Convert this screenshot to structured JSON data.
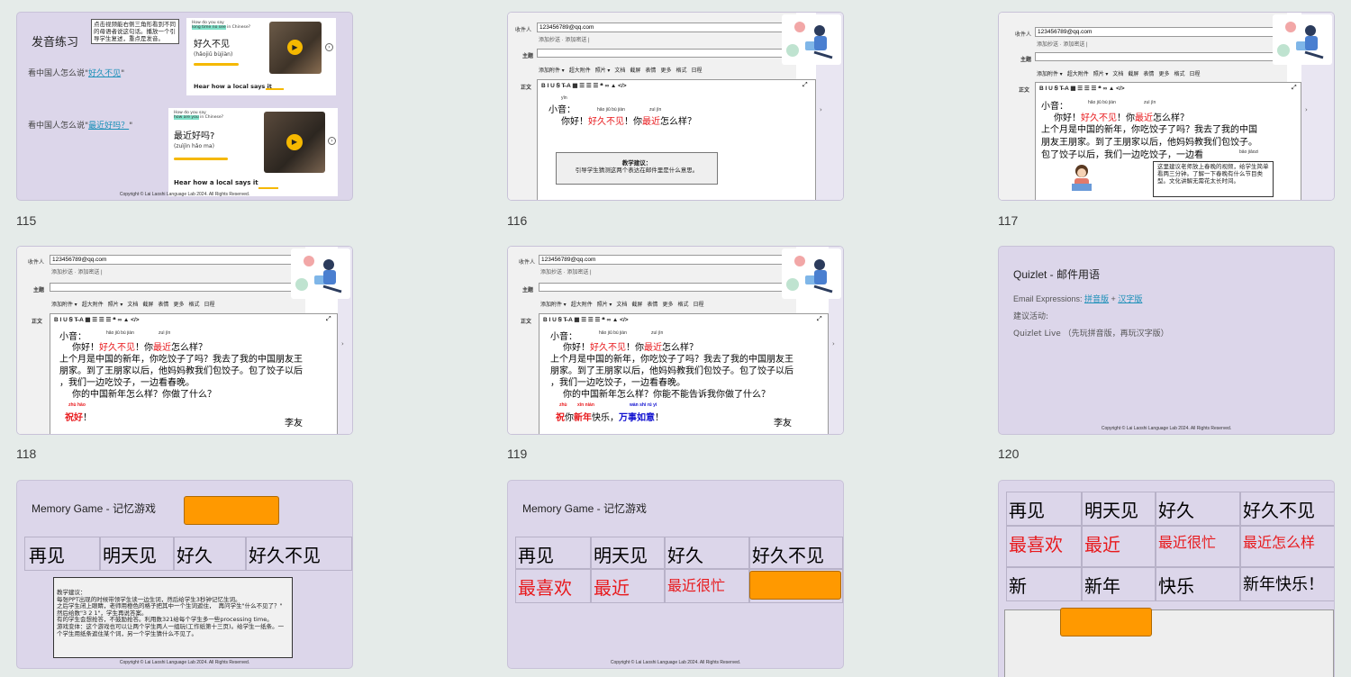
{
  "slides": {
    "s115": {
      "number": "115",
      "title": "发音练习",
      "callout": "点击视频能右侧三角形看到不同的母语者说这句话。播放一个引导学生复述，重点是发音。",
      "line1_prefix": "看中国人怎么说\"",
      "line1_link": "好久不见",
      "line1_suffix": "\"",
      "line2_prefix": "看中国人怎么说\"",
      "line2_link": "最近好吗？",
      "line2_suffix": "\"",
      "card1": {
        "q_top": "How do you say",
        "q_hl": "long time no see",
        "q_rest": " in Chinese?",
        "phrase": "好久不见",
        "pinyin": "(hǎojiǔ bùjiàn)",
        "hear": "Hear how a local says it"
      },
      "card2": {
        "q_top": "How do you say",
        "q_hl": "how are you",
        "q_rest": " in Chinese?",
        "phrase": "最近好吗?",
        "pinyin": "(zuìjìn hǎo ma)",
        "hear": "Hear how a local says it"
      },
      "copyright": "Copyright © Lai Laoshi Language Lab 2024. All Rights Reserved."
    },
    "s116": {
      "number": "116",
      "to_label": "收件人",
      "to_value": "123456789@qq.com",
      "links": "添加抄送 · 添加密送 |",
      "subject_label": "主题",
      "body_label": "正文",
      "toolbar": [
        "添加附件 ▾",
        "超大附件",
        "照片 ▾",
        "文档",
        "截屏",
        "表情",
        "更多",
        "格式",
        "日程"
      ],
      "fmt": "B  I  U  Ꞩ  T̶  A  ▦  ☰  ☰  ☰  ❝  ∞  ▲  </>",
      "py_yin": "yīn",
      "py1": "hǎo jiǔ bù jiàn",
      "py2": "zuì jìn",
      "greet": "小音：",
      "l1a": "你好！",
      "l1b": "好久不见",
      "l1c": "！你",
      "l1d": "最近",
      "l1e": "怎么样？",
      "note_title": "教学建议：",
      "note_body": "引导学生猜测这两个表达在邮件里是什么意思。"
    },
    "s117": {
      "number": "117",
      "to_label": "收件人",
      "to_value": "123456789@qq.com",
      "links": "添加抄送 · 添加密送 |",
      "subject_label": "主题",
      "body_label": "正文",
      "toolbar": [
        "添加附件 ▾",
        "超大附件",
        "照片 ▾",
        "文档",
        "截屏",
        "表情",
        "更多",
        "格式",
        "日程"
      ],
      "fmt": "B  I  U  Ꞩ  T̶  A  ▦  ☰  ☰  ☰  ❝  ∞  ▲  </>",
      "py1": "hǎo jiǔ bù jiàn",
      "py2": "zuì jìn",
      "py3": "bāo jiǎozi",
      "greet": "小音：",
      "l1a": "你好！",
      "l1b": "好久不见",
      "l1c": "！你",
      "l1d": "最近",
      "l1e": "怎么样？",
      "l2": "上个月是中国的新年，你吃饺子了吗？我去了我的中国",
      "l3": "朋友王朋家。到了王朋家以后，他妈妈教我们包饺子。",
      "l4": "包了饺子以后，我们一边吃饺子，一边看",
      "note": "这里建议老师放上春晚的视频，给学生简单看两三分钟。了解一下春晚有什么节目类型。文化讲解无需花太长时间。"
    },
    "s118": {
      "number": "118",
      "to_label": "收件人",
      "to_value": "123456789@qq.com",
      "links": "添加抄送 · 添加密送 |",
      "subject_label": "主题",
      "body_label": "正文",
      "toolbar": [
        "添加附件 ▾",
        "超大附件",
        "照片 ▾",
        "文档",
        "截屏",
        "表情",
        "更多",
        "格式",
        "日程"
      ],
      "fmt": "B  I  U  Ꞩ  T̶  A  ▦  ☰  ☰  ☰  ❝  ∞  ▲  </>",
      "py1": "hǎo jiǔ bù jiàn",
      "py2": "zuì jìn",
      "py_zhu": "zhù hǎo",
      "greet": "小音：",
      "l1a": "你好！",
      "l1b": "好久不见",
      "l1c": "！你",
      "l1d": "最近",
      "l1e": "怎么样？",
      "l2": "上个月是中国的新年，你吃饺子了吗？我去了我的中国朋友王",
      "l3": "朋家。到了王朋家以后，他妈妈教我们包饺子。包了饺子以后",
      "l4": "，我们一边吃饺子，一边看春晚。",
      "l5": "你的中国新年怎么样？你做了什么？",
      "wish": "祝好",
      "wish_end": "！",
      "sign": "李友"
    },
    "s119": {
      "number": "119",
      "to_label": "收件人",
      "to_value": "123456789@qq.com",
      "links": "添加抄送 · 添加密送 |",
      "subject_label": "主题",
      "body_label": "正文",
      "toolbar": [
        "添加附件 ▾",
        "超大附件",
        "照片 ▾",
        "文档",
        "截屏",
        "表情",
        "更多",
        "格式",
        "日程"
      ],
      "fmt": "B  I  U  Ꞩ  T̶  A  ▦  ☰  ☰  ☰  ❝  ∞  ▲  </>",
      "py1": "hǎo jiǔ bù jiàn",
      "py2": "zuì jìn",
      "py_zhu": "zhù",
      "py_xin": "xīn nián",
      "py_wan": "wàn shì rú  yì",
      "greet": "小音：",
      "l1a": "你好！",
      "l1b": "好久不见",
      "l1c": "！你",
      "l1d": "最近",
      "l1e": "怎么样？",
      "l2": "上个月是中国的新年，你吃饺子了吗？我去了我的中国朋友王",
      "l3": "朋家。到了王朋家以后，他妈妈教我们包饺子。包了饺子以后",
      "l4": "，我们一边吃饺子，一边看春晚。",
      "l5": "你的中国新年怎么样？你能不能告诉我你做了什么？",
      "w1": "祝",
      "w2": "你",
      "w3": "新年",
      "w4": "快乐，",
      "w5": "万事如意",
      "w6": "！",
      "sign": "李友"
    },
    "s120": {
      "number": "120",
      "title": "Quizlet - 邮件用语",
      "expr_prefix": "Email Expressions: ",
      "link1": "拼音版",
      "plus": " + ",
      "link2": "汉字版",
      "activity": "建议活动:",
      "live": "Quizlet Live （先玩拼音版，再玩汉字版）",
      "copyright": "Copyright © Lai Laoshi Language Lab 2024. All Rights Reserved."
    },
    "s121": {
      "title": "Memory Game - 记忆游戏",
      "words": [
        "再见",
        "明天见",
        "好久",
        "好久不见"
      ],
      "note": "教学建议：\n每张PPT出现的时候带领学生读一边生词，然后给学生3秒钟记忆生词。\n之后学生闭上眼睛，老师用橙色的格子把其中一个生词遮住，  再问学生\"什么不见了？\" 然后给数\"3 2 1\"，学生再说答案。\n有的学生会想抢答，不鼓励抢答。利用数321给每个学生多一些processing time。\n游戏变体：这个游戏也可以让两个学生两人一组玩(工作纸第十三页)。给学生一纸条。一个学生用纸条遮住某个词，另一个学生猜什么不见了。",
      "copyright": "Copyright © Lai Laoshi Language Lab 2024. All Rights Reserved."
    },
    "s122": {
      "title": "Memory Game - 记忆游戏",
      "row1": [
        "再见",
        "明天见",
        "好久",
        "好久不见"
      ],
      "row2": [
        "最喜欢",
        "最近",
        "最近很忙"
      ],
      "copyright": "Copyright © Lai Laoshi Language Lab 2024. All Rights Reserved."
    },
    "s123": {
      "row1": [
        "再见",
        "明天见",
        "好久",
        "好久不见"
      ],
      "row2": [
        "最喜欢",
        "最近",
        "最近很忙",
        "最近怎么样"
      ],
      "row3": [
        "新",
        "新年",
        "快乐",
        "新年快乐！"
      ]
    }
  },
  "colors": {
    "slide_bg": "#dcd6ea",
    "accent_red": "#e8191c",
    "orange": "#ff9900",
    "link": "#1a8fb8",
    "blue_text": "#1010d0"
  }
}
